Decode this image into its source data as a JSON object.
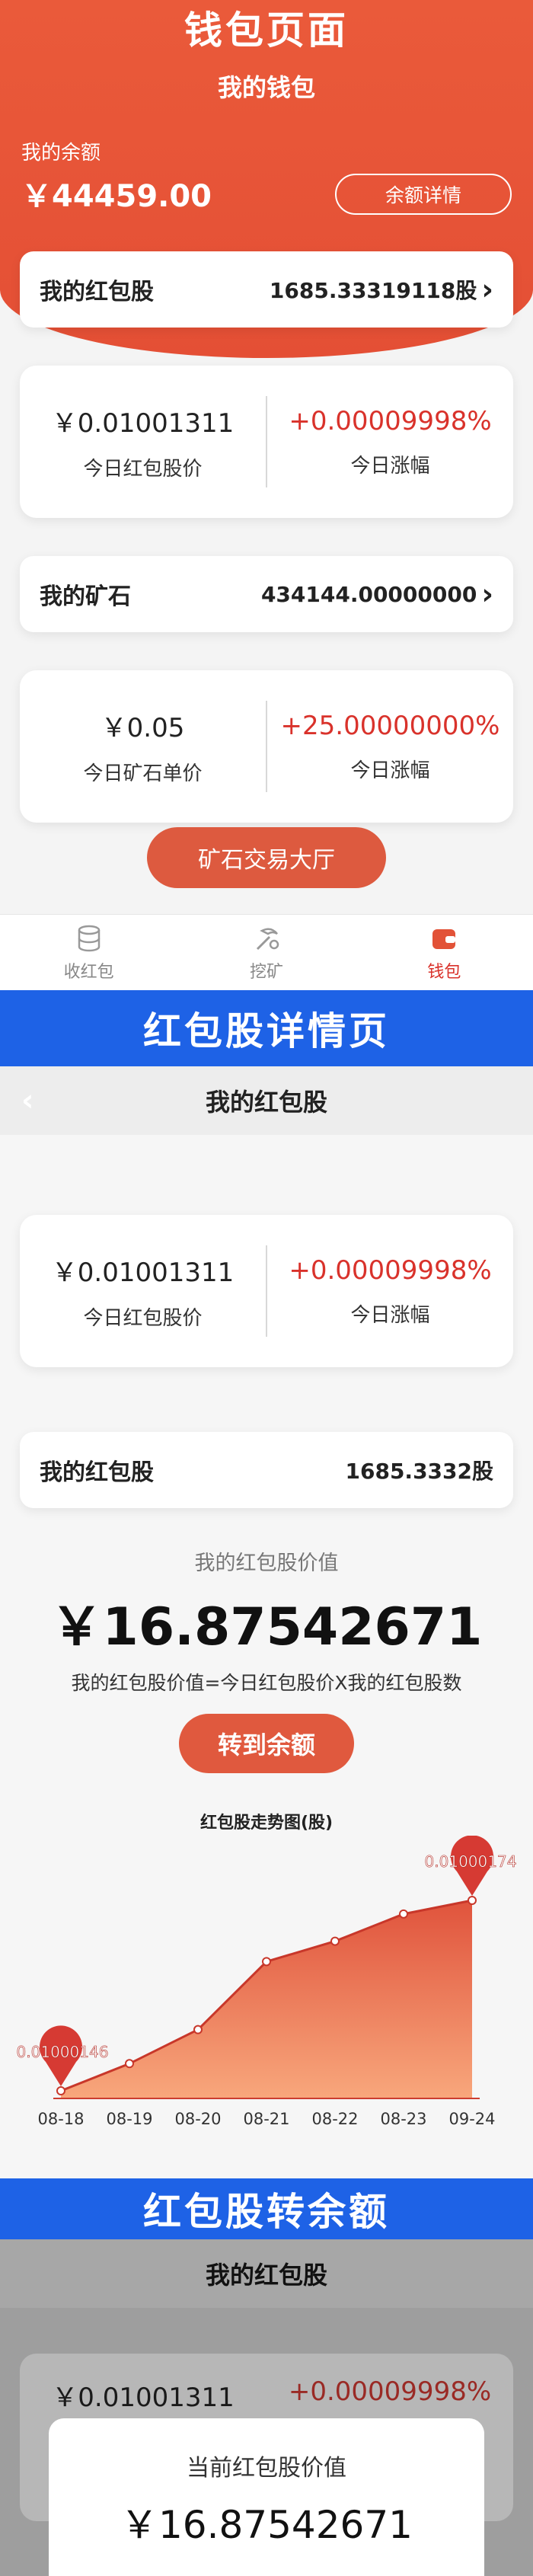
{
  "banners": {
    "wallet": "钱包页面",
    "detail": "红包股详情页",
    "transfer": "红包股转余额"
  },
  "wallet": {
    "title": "我的钱包",
    "balance_label": "我的余额",
    "balance_value": "￥44459.00",
    "balance_detail_button": "余额详情",
    "hongbao": {
      "label": "我的红包股",
      "value": "1685.33319118股"
    },
    "hongbao_stats": {
      "price": "￥0.01001311",
      "price_label": "今日红包股价",
      "change": "+0.00009998%",
      "change_label": "今日涨幅"
    },
    "ore": {
      "label": "我的矿石",
      "value": "434144.00000000"
    },
    "ore_stats": {
      "price": "￥0.05",
      "price_label": "今日矿石单价",
      "change": "+25.00000000%",
      "change_label": "今日涨幅"
    },
    "trade_button": "矿石交易大厅",
    "tabs": [
      {
        "label": "收红包",
        "icon": "database-icon"
      },
      {
        "label": "挖矿",
        "icon": "pickaxe-icon"
      },
      {
        "label": "钱包",
        "icon": "wallet-icon",
        "active": true
      }
    ]
  },
  "detail": {
    "title": "我的红包股",
    "stats": {
      "price": "￥0.01001311",
      "price_label": "今日红包股价",
      "change": "+0.00009998%",
      "change_label": "今日涨幅"
    },
    "holding": {
      "label": "我的红包股",
      "value": "1685.3332股"
    },
    "value_label": "我的红包股价值",
    "value_amount": "￥16.87542671",
    "formula": "我的红包股价值=今日红包股价X我的红包股数",
    "transfer_button": "转到余额"
  },
  "chart_data": {
    "type": "area",
    "title": "红包股走势图(股)",
    "x": [
      "08-18",
      "08-19",
      "08-20",
      "08-21",
      "08-22",
      "08-23",
      "09-24"
    ],
    "y": [
      0.01000146,
      0.0100015,
      0.01000155,
      0.01000165,
      0.01000168,
      0.01000172,
      0.01000174
    ],
    "markers": [
      {
        "label": "0.01000146",
        "index": 0
      },
      {
        "label": "0.01000174",
        "index": 6
      }
    ],
    "colors": {
      "fill_top": "#e0533c",
      "fill_bottom": "#f8a77c",
      "line": "#c8372a",
      "marker": "#d63a33"
    }
  },
  "transfer": {
    "title": "我的红包股",
    "stats_price": "￥0.01001311",
    "stats_change": "+0.00009998%",
    "modal_label": "当前红包股价值",
    "modal_value": "￥16.87542671"
  }
}
